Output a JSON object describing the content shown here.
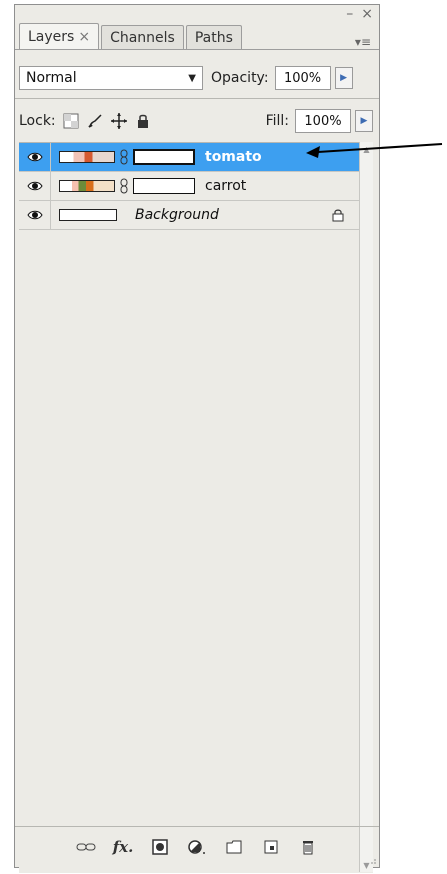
{
  "window": {
    "minimize_label": "–",
    "close_label": "×",
    "menu_label": "▾≡"
  },
  "tabs": [
    {
      "label": "Layers",
      "close": "×"
    },
    {
      "label": "Channels"
    },
    {
      "label": "Paths"
    }
  ],
  "blend_mode": {
    "value": "Normal"
  },
  "opacity": {
    "label": "Opacity:",
    "value": "100%"
  },
  "lock": {
    "label": "Lock:"
  },
  "fill": {
    "label": "Fill:",
    "value": "100%"
  },
  "layers": [
    {
      "name": "tomato",
      "selected": true
    },
    {
      "name": "carrot",
      "selected": false
    },
    {
      "name": "Background",
      "selected": false
    }
  ],
  "icons": {
    "eye": "eye-icon",
    "chain": "chain-icon",
    "lock": "lock-icon",
    "link": "link-layers-icon",
    "fx": "fx-icon",
    "mask": "add-mask-icon",
    "adjustment": "adjustment-layer-icon",
    "group": "new-group-icon",
    "new_layer": "new-layer-icon",
    "trash": "trash-icon"
  },
  "colors": {
    "selected_row": "#3d9ff0"
  }
}
